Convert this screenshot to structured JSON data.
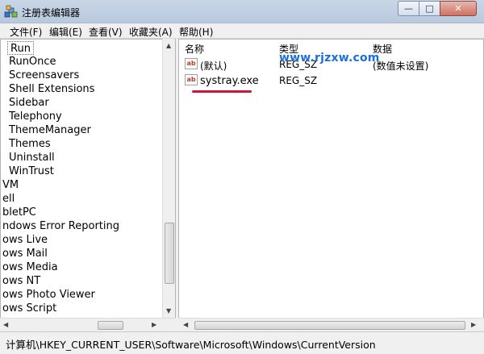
{
  "window": {
    "title": "注册表编辑器",
    "minimize": "—",
    "maximize": "□",
    "close": "✕"
  },
  "menubar": [
    "文件(F)",
    "编辑(E)",
    "查看(V)",
    "收藏夹(A)",
    "帮助(H)"
  ],
  "tree": {
    "selected": "Run",
    "items": [
      "RunOnce",
      "Screensavers",
      "Shell Extensions",
      "Sidebar",
      "Telephony",
      "ThemeManager",
      "Themes",
      "Uninstall",
      "WinTrust",
      "VM",
      "ell",
      "bletPC",
      "ndows Error Reporting",
      "ows Live",
      "ows Mail",
      "ows Media",
      "ows NT",
      "ows Photo Viewer",
      "ows Script"
    ]
  },
  "list": {
    "columns": [
      "名称",
      "类型",
      "数据"
    ],
    "rows": [
      {
        "name": "(默认)",
        "type": "REG_SZ",
        "data": "(数值未设置)"
      },
      {
        "name": "systray.exe",
        "type": "REG_SZ",
        "data": ""
      }
    ]
  },
  "icons": {
    "app": "registry-editor-icon",
    "value": "string-value-icon"
  },
  "watermark": "www.rjzxw.com",
  "status": "计算机\\HKEY_CURRENT_USER\\Software\\Microsoft\\Windows\\CurrentVersion",
  "colors": {
    "annotation_underline": "#d0143c",
    "watermark": "#1e6fd9"
  }
}
